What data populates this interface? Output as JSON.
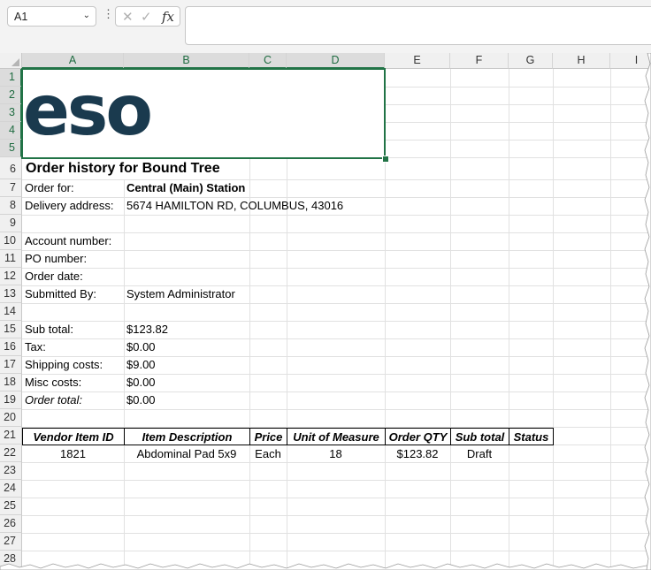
{
  "formula_bar": {
    "name_box": "A1",
    "formula": ""
  },
  "columns": [
    "A",
    "B",
    "C",
    "D",
    "E",
    "F",
    "G",
    "H",
    "I"
  ],
  "rows": [
    "1",
    "2",
    "3",
    "4",
    "5",
    "6",
    "7",
    "8",
    "9",
    "10",
    "11",
    "12",
    "13",
    "14",
    "15",
    "16",
    "17",
    "18",
    "19",
    "20",
    "21",
    "22",
    "23",
    "24",
    "25",
    "26",
    "27",
    "28"
  ],
  "logo_text": "eso",
  "sheet": {
    "title": "Order history for Bound Tree",
    "order_for_label": "Order for:",
    "order_for_value": "Central (Main) Station",
    "delivery_label": "Delivery address:",
    "delivery_value": "5674 HAMILTON RD, COLUMBUS, 43016",
    "account_label": "Account number:",
    "po_label": "PO number:",
    "order_date_label": "Order date:",
    "submitted_label": "Submitted By:",
    "submitted_value": "System Administrator",
    "subtotal_label": "Sub total:",
    "subtotal_value": "$123.82",
    "tax_label": "Tax:",
    "tax_value": "$0.00",
    "shipping_label": "Shipping costs:",
    "shipping_value": "$9.00",
    "misc_label": "Misc costs:",
    "misc_value": "$0.00",
    "total_label": "Order total:",
    "total_value": "$0.00"
  },
  "table": {
    "headers": [
      "Vendor Item ID",
      "Item Description",
      "Price",
      "Unit of Measure",
      "Order QTY",
      "Sub total",
      "Status"
    ],
    "row": [
      "1821",
      "Abdominal Pad 5x9",
      "Each",
      "18",
      "$123.82",
      "Draft",
      ""
    ]
  }
}
